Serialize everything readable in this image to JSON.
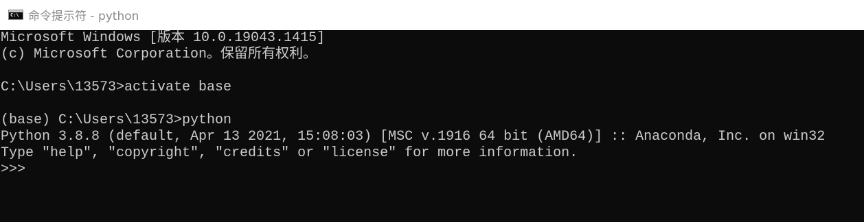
{
  "window": {
    "title": "命令提示符 - python",
    "icon_text": "C:\\",
    "icon": "cmd-icon"
  },
  "colors": {
    "titlebar_bg": "#ffffff",
    "console_bg": "#0c0c0c",
    "console_text": "#cccccc",
    "title_text": "#8a8a8a"
  },
  "console": {
    "lines": [
      "Microsoft Windows [版本 10.0.19043.1415]",
      "(c) Microsoft Corporation。保留所有权利。",
      "",
      "C:\\Users\\13573>activate base",
      "",
      "(base) C:\\Users\\13573>python",
      "Python 3.8.8 (default, Apr 13 2021, 15:08:03) [MSC v.1916 64 bit (AMD64)] :: Anaconda, Inc. on win32",
      "Type \"help\", \"copyright\", \"credits\" or \"license\" for more information.",
      ">>>"
    ]
  }
}
